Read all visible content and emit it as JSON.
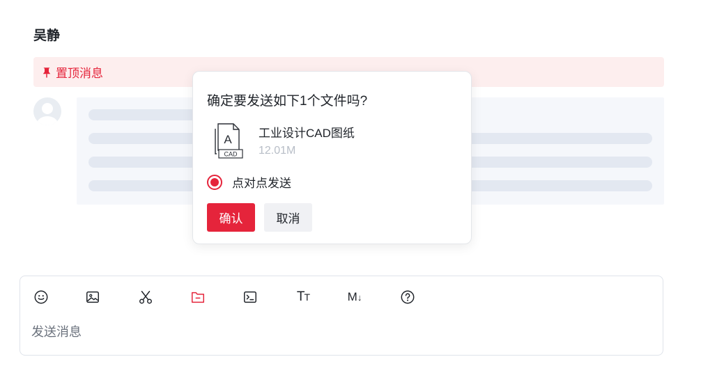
{
  "chat": {
    "title": "吴静"
  },
  "pinned": {
    "label": "置顶消息",
    "icon": "pin-icon",
    "color": "#e5243b"
  },
  "dialog": {
    "title": "确定要发送如下1个文件吗?",
    "file": {
      "name": "工业设计CAD图纸",
      "size": "12.01M",
      "icon_letter": "A",
      "icon_tag": "CAD"
    },
    "option": {
      "label": "点对点发送",
      "selected": true
    },
    "confirm_label": "确认",
    "cancel_label": "取消"
  },
  "composer": {
    "placeholder": "发送消息",
    "tools": [
      "emoji-icon",
      "image-icon",
      "scissors-icon",
      "folder-icon",
      "terminal-icon",
      "text-size-icon",
      "markdown-icon",
      "help-icon"
    ],
    "text_size_glyph": "TT",
    "markdown_glyph": "M↓"
  },
  "colors": {
    "accent": "#e5243b",
    "pinned_bg": "#fdeeee",
    "skeleton": "#e3e8f1"
  }
}
